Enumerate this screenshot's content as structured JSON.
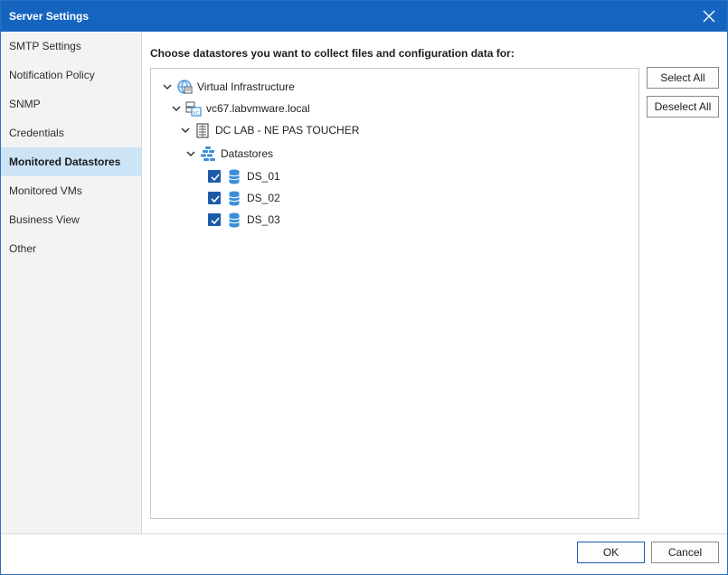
{
  "window": {
    "title": "Server Settings"
  },
  "sidebar": {
    "items": [
      {
        "label": "SMTP Settings",
        "active": false
      },
      {
        "label": "Notification Policy",
        "active": false
      },
      {
        "label": "SNMP",
        "active": false
      },
      {
        "label": "Credentials",
        "active": false
      },
      {
        "label": "Monitored Datastores",
        "active": true
      },
      {
        "label": "Monitored VMs",
        "active": false
      },
      {
        "label": "Business View",
        "active": false
      },
      {
        "label": "Other",
        "active": false
      }
    ]
  },
  "main": {
    "heading": "Choose datastores you want to collect files and configuration data for:",
    "tree": {
      "root": "Virtual Infrastructure",
      "vcenter": "vc67.labvmware.local",
      "datacenter": "DC LAB - NE PAS TOUCHER",
      "folder": "Datastores",
      "datastores": [
        {
          "name": "DS_01",
          "checked": true
        },
        {
          "name": "DS_02",
          "checked": true
        },
        {
          "name": "DS_03",
          "checked": true
        }
      ]
    },
    "select_all": "Select All",
    "deselect_all": "Deselect All"
  },
  "footer": {
    "ok": "OK",
    "cancel": "Cancel"
  },
  "colors": {
    "titlebar": "#1565c0",
    "active_nav": "#cde4f7",
    "checkbox": "#1d5ba8",
    "icon_blue": "#3a8fd8"
  }
}
